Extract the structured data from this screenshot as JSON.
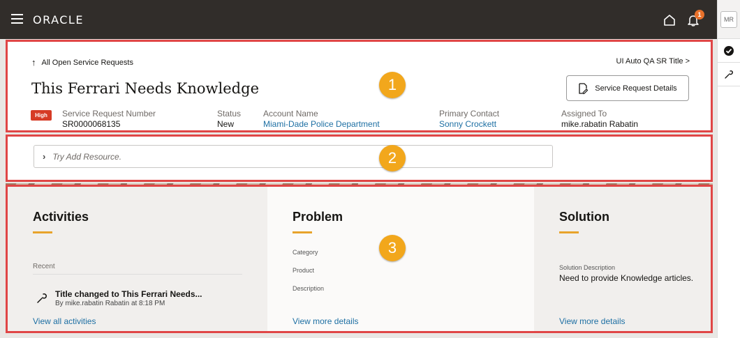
{
  "topbar": {
    "logo": "ORACLE",
    "notification_count": "1"
  },
  "rail": {
    "avatar_initials": "MR"
  },
  "header": {
    "back_link": "All Open Service Requests",
    "next_link": "UI Auto QA SR Title >",
    "title": "This Ferrari Needs Knowledge",
    "details_button": "Service Request Details",
    "priority_badge": "High",
    "fields": [
      {
        "label": "Service Request Number",
        "value": "SR0000068135"
      },
      {
        "label": "Status",
        "value": "New"
      },
      {
        "label": "Account Name",
        "value": "Miami-Dade Police Department"
      },
      {
        "label": "Primary Contact",
        "value": "Sonny Crockett"
      },
      {
        "label": "Assigned To",
        "value": "mike.rabatin Rabatin"
      }
    ]
  },
  "resource": {
    "placeholder": "Try Add Resource."
  },
  "callouts": [
    "1",
    "2",
    "3"
  ],
  "activities": {
    "title": "Activities",
    "recent_label": "Recent",
    "item_title": "Title changed to This Ferrari Needs...",
    "item_sub": "By mike.rabatin Rabatin at 8:18 PM",
    "link": "View all activities"
  },
  "problem": {
    "title": "Problem",
    "fields": [
      "Category",
      "Product",
      "Description"
    ],
    "link": "View more details"
  },
  "solution": {
    "title": "Solution",
    "desc_label": "Solution Description",
    "desc_value": "Need to provide Knowledge articles.",
    "link": "View more details"
  },
  "colors": {
    "topbar": "#312d2a",
    "highlight_border": "#e04646",
    "callout": "#f2a71c",
    "link": "#1d6fa3",
    "badge_high": "#d63b25",
    "accent": "#e8a32b"
  }
}
